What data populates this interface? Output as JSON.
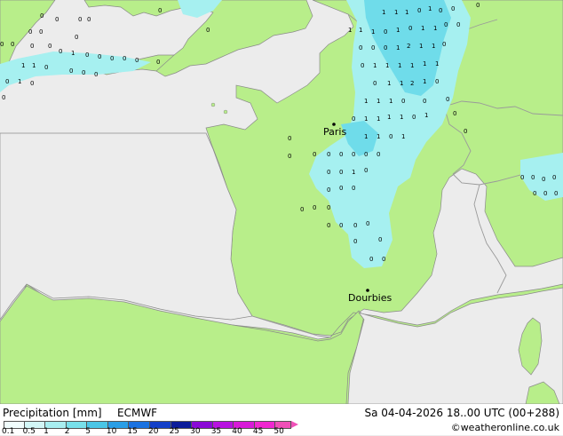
{
  "map": {
    "colors": {
      "sea": "#ececec",
      "land": "#b8ee8a",
      "border": "#9a9a9a",
      "precip_light": "#a6f0f0",
      "precip_med": "#6fdcea"
    },
    "cities": [
      {
        "name": "Paris"
      },
      {
        "name": "Dourbies"
      }
    ]
  },
  "legend": {
    "title": "Precipitation [mm]",
    "model": "ECMWF",
    "datetime": "Sa 04-04-2026 18..00 UTC (00+288)",
    "credit": "©weatheronline.co.uk",
    "ticks": [
      "0.1",
      "0.5",
      "1",
      "2",
      "5",
      "10",
      "15",
      "20",
      "25",
      "30",
      "35",
      "40",
      "45",
      "50"
    ],
    "colors": [
      "#f0fcfc",
      "#d2f6f6",
      "#a8eef0",
      "#78e0ea",
      "#4ac6e6",
      "#2a9ee6",
      "#1a72e0",
      "#1440c8",
      "#0c1c9a",
      "#8a0ad6",
      "#b812e0",
      "#d81ad8",
      "#f028d0",
      "#f050b8"
    ]
  }
}
